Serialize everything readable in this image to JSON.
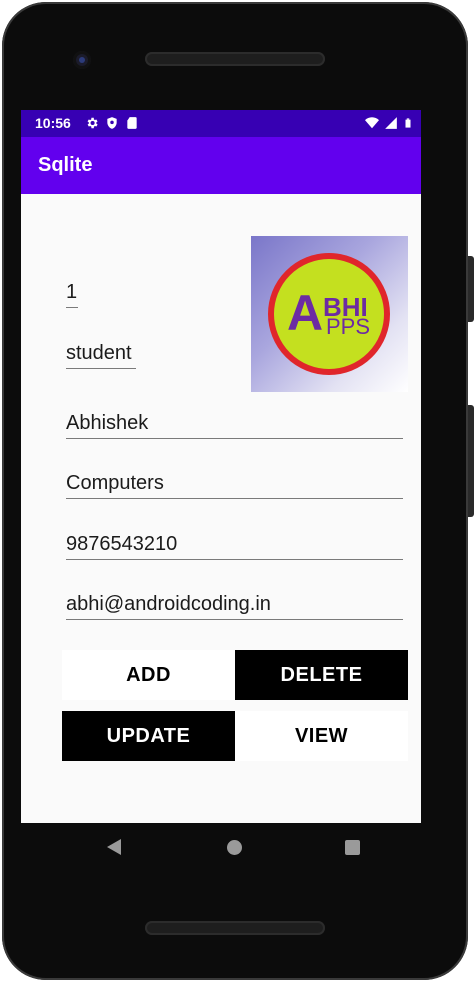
{
  "status_bar": {
    "time": "10:56",
    "icons_left": [
      "settings-gear-icon",
      "shield-icon",
      "sd-card-icon"
    ],
    "icons_right": [
      "wifi-icon",
      "cellular-signal-icon",
      "battery-icon"
    ],
    "color": "#3700b3"
  },
  "app_bar": {
    "title": "Sqlite",
    "color": "#6200ee"
  },
  "form": {
    "id_value": "1",
    "table_value": "student",
    "name_value": "Abhishek",
    "department_value": "Computers",
    "phone_value": "9876543210",
    "email_value": "abhi@androidcoding.in"
  },
  "logo": {
    "text_top": "BHI",
    "text_bottom": "PPS",
    "letter_a1": "A",
    "letter_a2": "A",
    "ring_color": "#e0262b",
    "fill_color": "#c4e01f",
    "text_color": "#6c2ba3"
  },
  "buttons": {
    "add": "ADD",
    "delete": "DELETE",
    "update": "UPDATE",
    "view": "VIEW"
  },
  "nav": {
    "back": "back-icon",
    "home": "home-icon",
    "recent": "recent-apps-icon"
  }
}
